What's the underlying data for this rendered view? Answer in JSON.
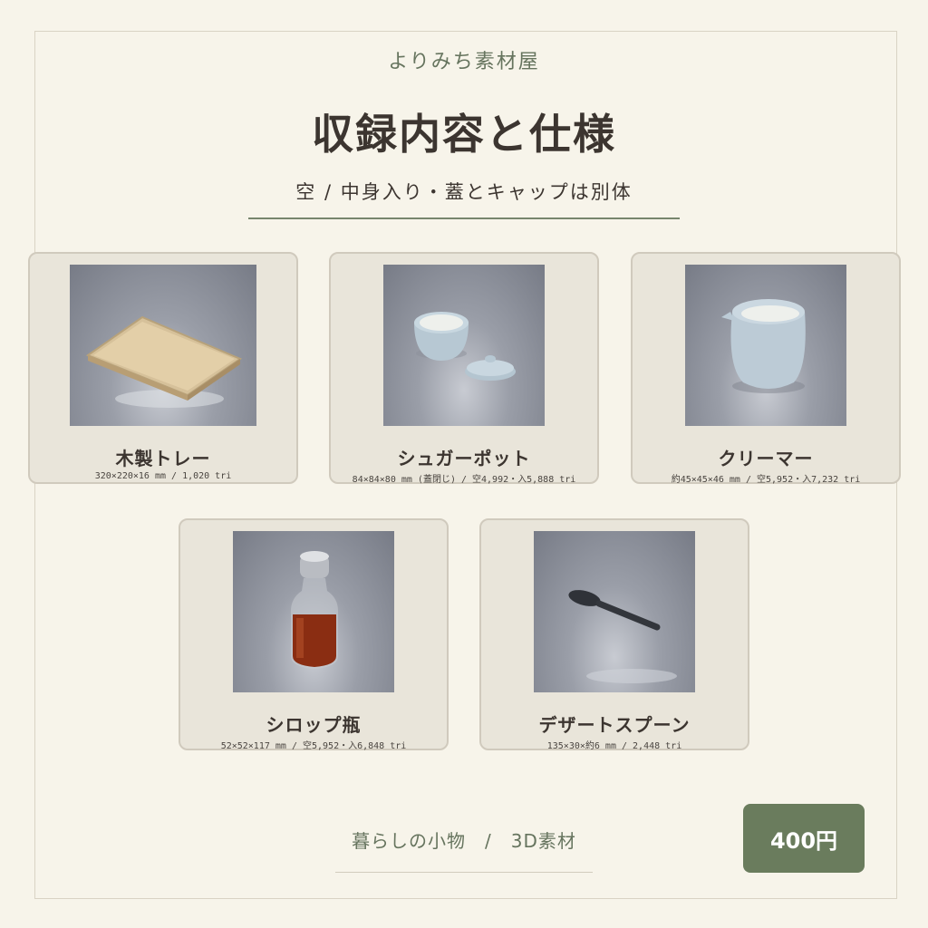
{
  "header": {
    "shop_name": "よりみち素材屋",
    "title": "収録内容と仕様",
    "subtitle": "空 / 中身入り・蓋とキャップは別体"
  },
  "items": [
    {
      "name": "木製トレー",
      "spec": "320×220×16 mm / 1,020 tri",
      "icon": "wooden-tray"
    },
    {
      "name": "シュガーポット",
      "spec": "84×84×80 mm (蓋閉じ) / 空4,992・入5,888 tri",
      "icon": "sugar-pot"
    },
    {
      "name": "クリーマー",
      "spec": "約45×45×46 mm / 空5,952・入7,232 tri",
      "icon": "creamer"
    },
    {
      "name": "シロップ瓶",
      "spec": "52×52×117 mm / 空5,952・入6,848 tri",
      "icon": "syrup-bottle"
    },
    {
      "name": "デザートスプーン",
      "spec": "135×30×約6 mm / 2,448 tri",
      "icon": "dessert-spoon"
    }
  ],
  "footer": {
    "text": "暮らしの小物　/　3D素材"
  },
  "price": "400円",
  "colors": {
    "background": "#f7f4ea",
    "accent_green": "#6a7c5d",
    "card_bg": "#e9e5da",
    "text_dark": "#3c3530"
  }
}
